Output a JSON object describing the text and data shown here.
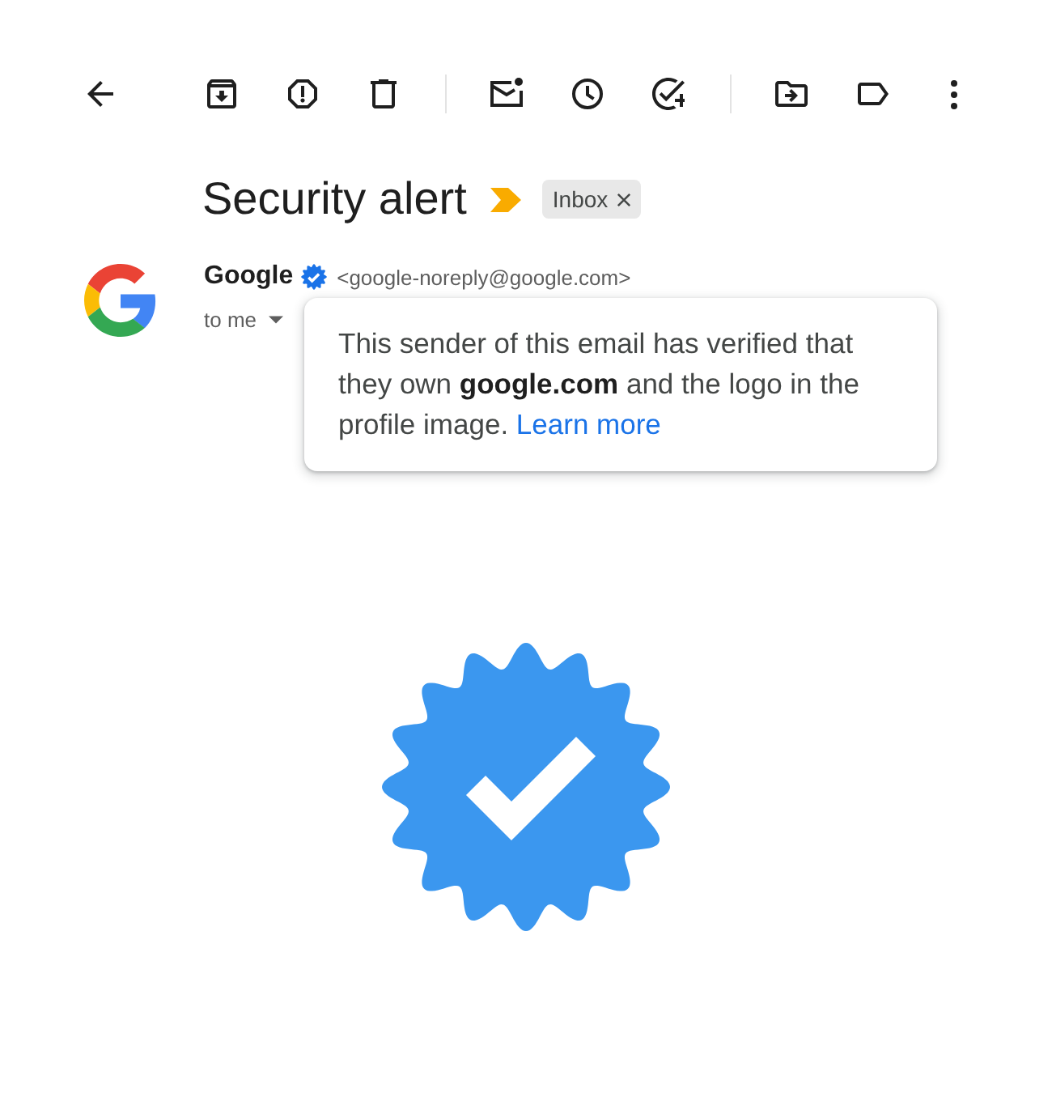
{
  "email": {
    "subject": "Security alert",
    "important": true,
    "labels": [
      {
        "name": "Inbox"
      }
    ],
    "sender": {
      "name": "Google",
      "verified": true,
      "address": "<google-noreply@google.com>"
    },
    "recipient": "to me"
  },
  "verification_tooltip": {
    "text": "This sender of this email has verified that they own **google.com** and the logo in the profile image.",
    "link": "Learn more"
  }
}
